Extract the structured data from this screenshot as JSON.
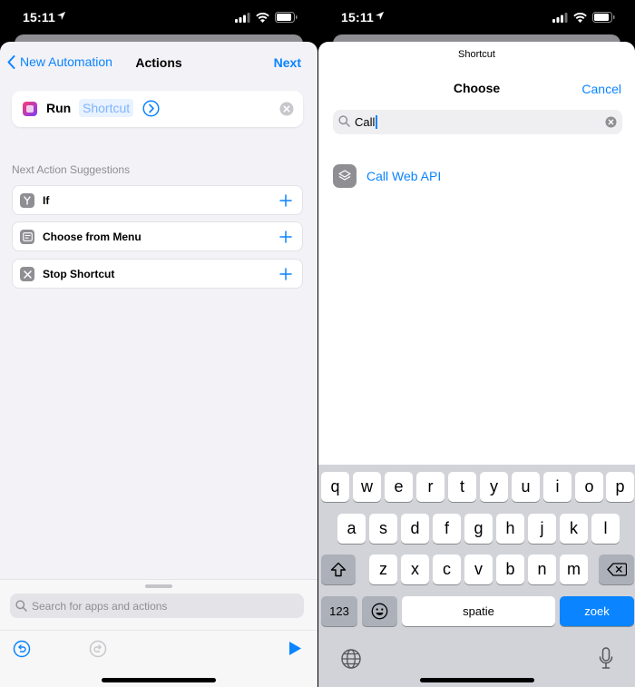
{
  "status": {
    "time": "15:11"
  },
  "left": {
    "nav": {
      "back_label": "New Automation",
      "title": "Actions",
      "next_label": "Next"
    },
    "run_card": {
      "verb": "Run",
      "param": "Shortcut"
    },
    "suggestions_label": "Next Action Suggestions",
    "suggestions": [
      {
        "label": "If"
      },
      {
        "label": "Choose from Menu"
      },
      {
        "label": "Stop Shortcut"
      }
    ],
    "search_placeholder": "Search for apps and actions"
  },
  "right": {
    "small_title": "Shortcut",
    "title": "Choose",
    "cancel_label": "Cancel",
    "search_value": "Call",
    "result_label": "Call Web API",
    "keyboard": {
      "row1": [
        "q",
        "w",
        "e",
        "r",
        "t",
        "y",
        "u",
        "i",
        "o",
        "p"
      ],
      "row2": [
        "a",
        "s",
        "d",
        "f",
        "g",
        "h",
        "j",
        "k",
        "l"
      ],
      "row3": [
        "z",
        "x",
        "c",
        "v",
        "b",
        "n",
        "m"
      ],
      "numbers_label": "123",
      "space_label": "spatie",
      "return_label": "zoek"
    }
  },
  "colors": {
    "accent": "#0a84ff",
    "sheet_bg": "#f2f2f7",
    "keyboard_bg": "#d1d3d9"
  }
}
